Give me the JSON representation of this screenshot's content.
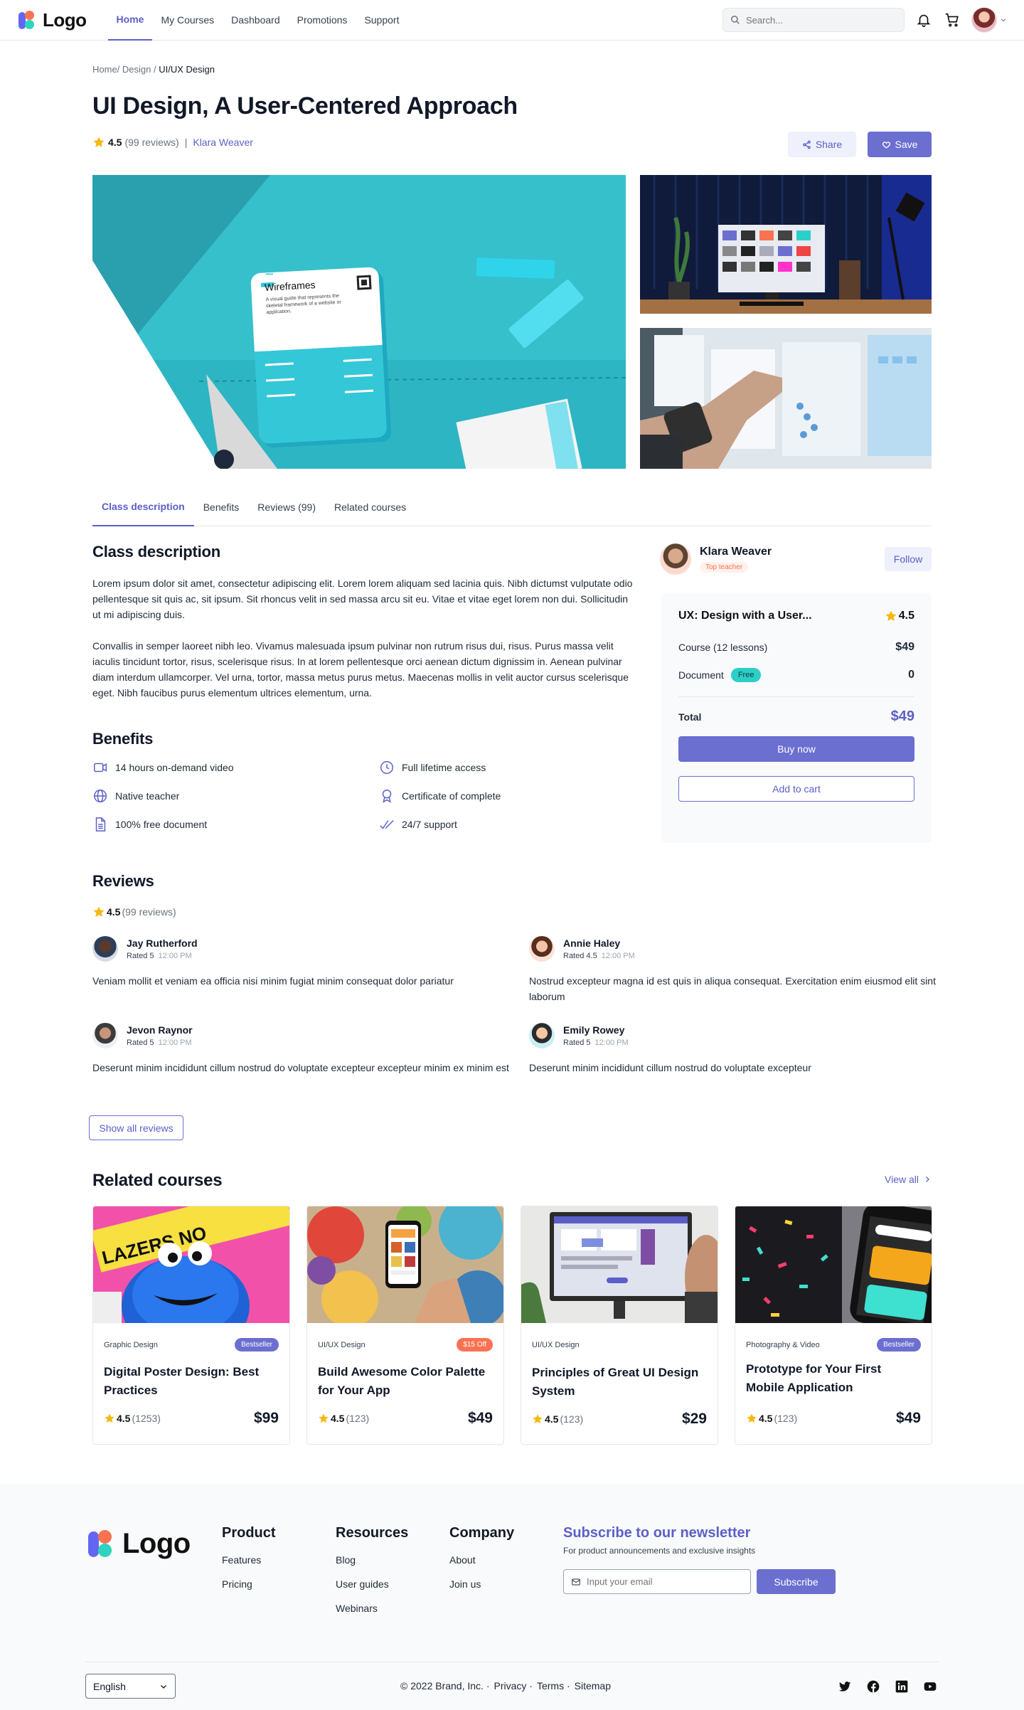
{
  "nav": {
    "logo": "Logo",
    "links": [
      {
        "label": "Home",
        "active": true
      },
      {
        "label": "My Courses",
        "active": false
      },
      {
        "label": "Dashboard",
        "active": false
      },
      {
        "label": "Promotions",
        "active": false
      },
      {
        "label": "Support",
        "active": false
      }
    ],
    "search_placeholder": "Search..."
  },
  "breadcrumb": {
    "home": "Home/",
    "design": " Design",
    "sep": " / ",
    "current": "UI/UX Design"
  },
  "course": {
    "title": "UI Design, A User-Centered Approach",
    "rating": "4.5",
    "reviews": "(99 reviews)",
    "separator": "|",
    "author": "Klara Weaver",
    "share_label": "Share",
    "save_label": "Save"
  },
  "gallery": {
    "card_tag": "▬▬",
    "card_title": "Wireframes",
    "card_desc": "A visual guide that represents the skeletal framework of a website or application."
  },
  "tabs": [
    {
      "label": "Class description",
      "active": true
    },
    {
      "label": "Benefits",
      "active": false
    },
    {
      "label": "Reviews (99)",
      "active": false
    },
    {
      "label": "Related courses",
      "active": false
    }
  ],
  "description": {
    "heading": "Class description",
    "p1": "Lorem ipsum dolor sit amet, consectetur adipiscing elit. Lorem lorem aliquam sed lacinia quis. Nibh dictumst vulputate odio pellentesque sit quis ac, sit ipsum. Sit rhoncus velit in sed massa arcu sit eu. Vitae et vitae eget lorem non dui. Sollicitudin ut mi adipiscing duis.",
    "p2": "Convallis in semper laoreet nibh leo. Vivamus malesuada ipsum pulvinar non rutrum risus dui, risus. Purus massa velit iaculis tincidunt tortor, risus, scelerisque risus. In at lorem pellentesque orci aenean dictum dignissim in. Aenean pulvinar diam interdum ullamcorper. Vel urna, tortor, massa metus purus metus. Maecenas mollis in velit auctor cursus scelerisque eget. Nibh faucibus purus elementum ultrices elementum, urna."
  },
  "benefits": {
    "heading": "Benefits",
    "items": [
      {
        "label": "14 hours on-demand video",
        "icon": "video-icon"
      },
      {
        "label": "Full lifetime access",
        "icon": "clock-icon"
      },
      {
        "label": "Native teacher",
        "icon": "globe-icon"
      },
      {
        "label": "Certificate of complete",
        "icon": "award-icon"
      },
      {
        "label": "100% free document",
        "icon": "document-icon"
      },
      {
        "label": "24/7  support",
        "icon": "double-check-icon"
      }
    ]
  },
  "teacher": {
    "name": "Klara Weaver",
    "badge": "Top teacher",
    "follow_label": "Follow"
  },
  "pricing": {
    "course_name": "UX: Design with a User...",
    "rating": "4.5",
    "course_label": "Course (12 lessons)",
    "course_price": "$49",
    "document_label": "Document",
    "document_badge": "Free",
    "document_price": "0",
    "total_label": "Total",
    "total_price": "$49",
    "buy_label": "Buy now",
    "cart_label": "Add to cart"
  },
  "reviews": {
    "heading": "Reviews",
    "rating": "4.5",
    "count": "(99 reviews)",
    "items": [
      {
        "name": "Jay Rutherford",
        "rated": "Rated 5",
        "time": "12:00 PM",
        "text": "Veniam mollit et veniam ea officia nisi minim fugiat minim consequat dolor pariatur"
      },
      {
        "name": "Annie Haley",
        "rated": "Rated 4.5",
        "time": "12:00 PM",
        "text": "Nostrud excepteur magna id est quis in aliqua consequat. Exercitation enim eiusmod elit sint laborum"
      },
      {
        "name": "Jevon Raynor",
        "rated": "Rated 5",
        "time": "12:00 PM",
        "text": "Deserunt minim incididunt cillum nostrud do voluptate excepteur excepteur minim ex minim est"
      },
      {
        "name": "Emily Rowey",
        "rated": "Rated 5",
        "time": "12:00 PM",
        "text": "Deserunt minim incididunt cillum nostrud do voluptate excepteur"
      }
    ],
    "show_all_label": "Show all reviews"
  },
  "related": {
    "heading": "Related courses",
    "view_all": "View all",
    "courses": [
      {
        "category": "Graphic Design",
        "badge": "Bestseller",
        "badge_color": "#6b6fd0",
        "title": "Digital Poster Design: Best Practices",
        "rating": "4.5",
        "count": "(1253)",
        "price": "$99"
      },
      {
        "category": "UI/UX Design",
        "badge": "$15 Off",
        "badge_color": "#f97352",
        "title": "Build Awesome Color Palette for Your App",
        "rating": "4.5",
        "count": "(123)",
        "price": "$49"
      },
      {
        "category": "UI/UX Design",
        "badge": "",
        "badge_color": "",
        "title": "Principles of Great UI Design System",
        "rating": "4.5",
        "count": "(123)",
        "price": "$29"
      },
      {
        "category": "Photography & Video",
        "badge": "Bestseller",
        "badge_color": "#6b6fd0",
        "title": "Prototype for Your First Mobile Application",
        "rating": "4.5",
        "count": "(123)",
        "price": "$49"
      }
    ]
  },
  "footer": {
    "logo": "Logo",
    "product": {
      "title": "Product",
      "links": [
        "Features",
        "Pricing"
      ]
    },
    "resources": {
      "title": "Resources",
      "links": [
        "Blog",
        "User guides",
        "Webinars"
      ]
    },
    "company": {
      "title": "Company",
      "links": [
        "About",
        "Join us"
      ]
    },
    "newsletter": {
      "title": "Subscribe to our newsletter",
      "subtitle": "For product announcements and exclusive insights",
      "placeholder": "Input your email",
      "button": "Subscribe"
    },
    "language": "English",
    "copyright": "© 2022 Brand, Inc. ·",
    "links": [
      "Privacy ·",
      "Terms ·",
      "Sitemap"
    ],
    "socials": [
      "twitter-icon",
      "facebook-icon",
      "linkedin-icon",
      "youtube-icon"
    ]
  },
  "colors": {
    "accent": "#6b6fd0",
    "star": "#f5b90f",
    "coral": "#f97352",
    "teal": "#2ccfc7"
  }
}
